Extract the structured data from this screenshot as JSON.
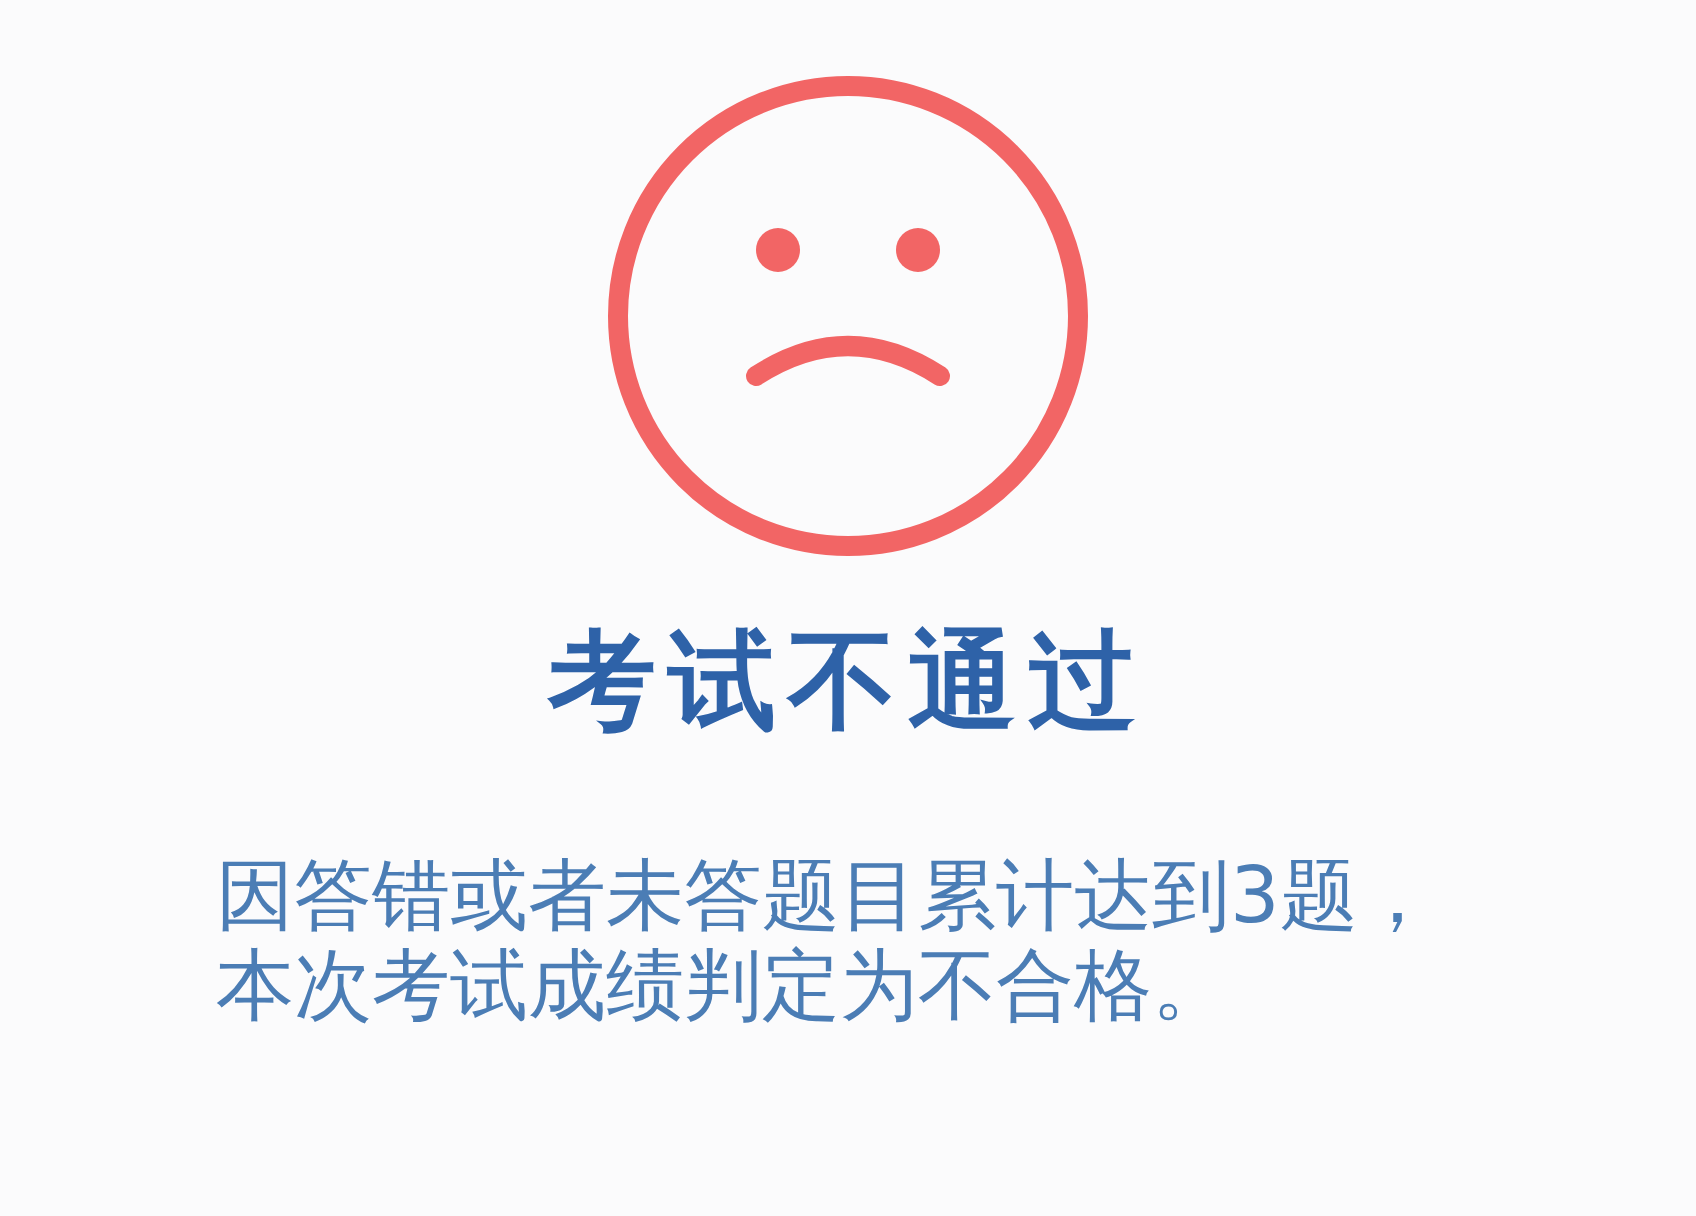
{
  "result": {
    "title": "考试不通过",
    "message": "因答错或者未答题目累计达到3题，本次考试成绩判定为不合格。"
  }
}
